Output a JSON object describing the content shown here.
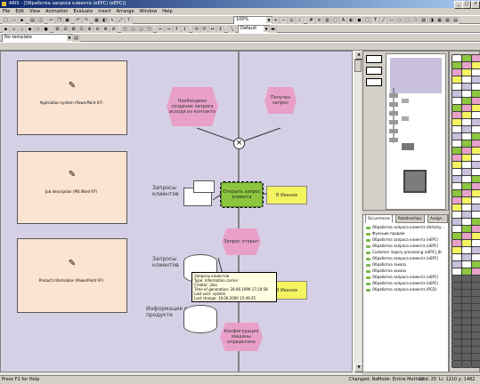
{
  "window": {
    "title": "ARIS - [Обработка запроса клиента (eEPC) (eEPC)]",
    "min": "_",
    "max": "□",
    "close": "×"
  },
  "menu": [
    "File",
    "Edit",
    "View",
    "Animation",
    "Evaluate",
    "Insert",
    "Arrange",
    "Window",
    "Help"
  ],
  "toolbar": {
    "zoom": "100%",
    "template": "No template",
    "line_style": "Default"
  },
  "canvas": {
    "systems": [
      {
        "label": "Application system (PowerPoint 97)"
      },
      {
        "label": "Job description (MS Word 97)"
      },
      {
        "label": "Product information (PowerPoint 97)"
      }
    ],
    "events": [
      {
        "label": "Необходимо создание запроса исходя из контакта"
      },
      {
        "label": "Получен запрос"
      },
      {
        "label": "Запрос открыт"
      },
      {
        "label": "Конфигурация машины определена"
      }
    ],
    "connector": "×",
    "function": "Открыть запрос клиента",
    "orgs": [
      "В Иванов",
      "В Иванов"
    ],
    "labels": [
      "Запросы клиентов",
      "Запросы клиентов",
      "Информация о продукте"
    ],
    "tooltip": [
      "Запросы клиентов",
      "Type: Information carrier",
      "Creator: jilea",
      "Time of generation: 28.06.1999 17:20:58",
      "Last user: system",
      "Last change: 19.06.2000 15:49:25"
    ]
  },
  "occurrences": {
    "tabs": [
      "Occurrences",
      "Relationships",
      "Assign…"
    ],
    "items": [
      {
        "label": "Обработка запроса клиента (Activity…",
        "color": "#7ab648"
      },
      {
        "label": "Функции продаж",
        "color": "#7ab648"
      },
      {
        "label": "Обработка запроса клиента (eEPC)",
        "color": "#7ab648"
      },
      {
        "label": "Обработка запроса клиента (eEPC)",
        "color": "#7ab648"
      },
      {
        "label": "Customer inquiry processing (eEPC)_8l",
        "color": "#7ab648"
      },
      {
        "label": "Обработка запроса клиента (eEPC)",
        "color": "#7ab648"
      },
      {
        "label": "Обработка заказа",
        "color": "#7ab648"
      },
      {
        "label": "Обработка заказа",
        "color": "#7ab648"
      },
      {
        "label": "Обработка запроса клиента (eEPC)",
        "color": "#7ab648"
      },
      {
        "label": "Обработка запроса клиента (eEPC)",
        "color": "#7ab648"
      },
      {
        "label": "Обработка запроса клиента (PCD)",
        "color": "#7ab648"
      }
    ]
  },
  "status": {
    "help": "Press F1 for Help",
    "changed": "Changed: No",
    "mode": "Mode: Entire Method",
    "grid": "Grid: 25",
    "coords": "Li: 1210 y: 1482"
  }
}
